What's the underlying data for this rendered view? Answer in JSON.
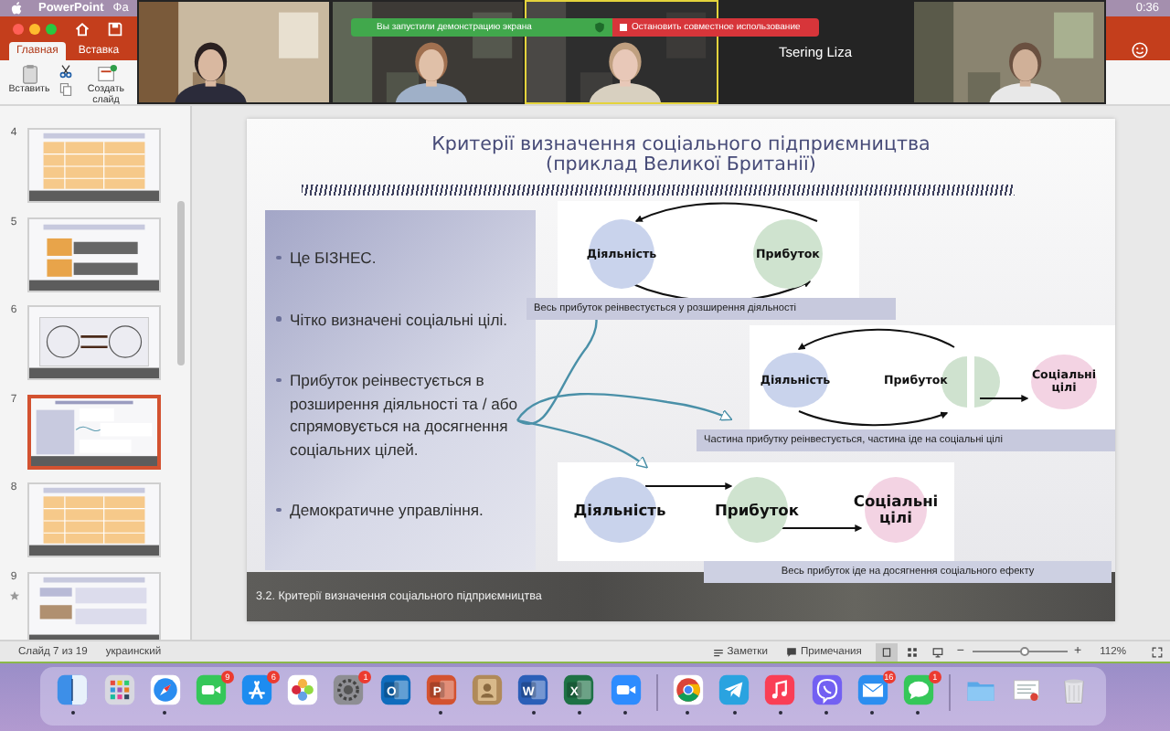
{
  "menu_bar": {
    "app": "PowerPoint",
    "menu_item": "Фа",
    "clock": "0:36"
  },
  "ribbon": {
    "tabs": [
      {
        "label": "Главная",
        "selected": true
      },
      {
        "label": "Вставка",
        "selected": false
      }
    ],
    "paste_label": "Вставить",
    "new_slide_label": "Создать слайд"
  },
  "meeting": {
    "share_notice": "Вы запустили демонстрацию экрана",
    "stop_share": "Остановить совместное использование",
    "participants": [
      {
        "kind": "picture",
        "active": false
      },
      {
        "kind": "picture",
        "active": false
      },
      {
        "kind": "picture",
        "active": true
      },
      {
        "kind": "name",
        "name": "Tsering Liza",
        "active": false
      },
      {
        "kind": "picture",
        "active": false
      }
    ]
  },
  "thumbnails": [
    {
      "number": "4",
      "kind": "table",
      "selected": false,
      "starred": false
    },
    {
      "number": "5",
      "kind": "boxes",
      "selected": false,
      "starred": false
    },
    {
      "number": "6",
      "kind": "cycle",
      "selected": false,
      "starred": false
    },
    {
      "number": "7",
      "kind": "criteria",
      "selected": true,
      "starred": false
    },
    {
      "number": "8",
      "kind": "table",
      "selected": false,
      "starred": false
    },
    {
      "number": "9",
      "kind": "mixed",
      "selected": false,
      "starred": true
    }
  ],
  "slide": {
    "title": [
      "Критерії визначення соціального підприємництва",
      "(приклад Великої Британії)"
    ],
    "bullets": [
      "Це БІЗНЕС.",
      "Чітко визначені соціальні цілі.",
      "Прибуток реінвестується в розширення діяльності та / або спрямовується на досягнення соціальних цілей.",
      "Демократичне управління."
    ],
    "diagrams": [
      {
        "kind": "cycle",
        "nodes": [
          "Діяльність",
          "Прибуток"
        ],
        "caption": "Весь прибуток реінвестується у розширення діяльності"
      },
      {
        "kind": "split",
        "nodes": [
          "Діяльність",
          "Прибуток",
          "Соціальні цілі"
        ],
        "caption": "Частина прибутку реінвестується, частина іде на соціальні цілі"
      },
      {
        "kind": "chain",
        "nodes": [
          "Діяльність",
          "Прибуток",
          "Соціальні цілі"
        ],
        "caption": "Весь прибуток іде на досягнення соціального ефекту"
      }
    ],
    "footer": "3.2. Критерії визначення соціального підприємництва"
  },
  "status_bar": {
    "slide_info": "Слайд 7 из 19",
    "language": "украинский",
    "notes": "Заметки",
    "comments": "Примечания",
    "views": [
      {
        "kind": "normal",
        "selected": true
      },
      {
        "kind": "sorter",
        "selected": false
      },
      {
        "kind": "reading",
        "selected": false
      }
    ],
    "zoom": {
      "minus": "−",
      "plus": "+",
      "level": 0.55,
      "value": "112%"
    }
  },
  "dock": {
    "groups": [
      [
        {
          "kind": "finder",
          "running": true
        },
        {
          "kind": "launchpad",
          "running": false
        },
        {
          "kind": "safari",
          "running": true
        },
        {
          "kind": "facetime",
          "badge": "9",
          "running": false
        },
        {
          "kind": "appstore",
          "badge": "6",
          "running": false
        },
        {
          "kind": "photos",
          "running": false
        },
        {
          "kind": "settings",
          "badge": "1",
          "running": false
        },
        {
          "kind": "outlook",
          "glyph": "O",
          "running": false
        },
        {
          "kind": "powerpoint",
          "glyph": "P",
          "running": true
        },
        {
          "kind": "contacts",
          "running": false
        },
        {
          "kind": "word",
          "glyph": "W",
          "running": true
        },
        {
          "kind": "excel",
          "glyph": "X",
          "running": true
        },
        {
          "kind": "zoom",
          "running": true
        }
      ],
      [
        {
          "kind": "chrome",
          "running": true
        },
        {
          "kind": "telegram",
          "running": true
        },
        {
          "kind": "music",
          "running": true
        },
        {
          "kind": "viber",
          "running": true
        },
        {
          "kind": "mail",
          "badge": "16",
          "running": true
        },
        {
          "kind": "messages",
          "badge": "1",
          "running": true
        }
      ],
      [
        {
          "kind": "folder",
          "running": false
        },
        {
          "kind": "downloads",
          "running": false
        },
        {
          "kind": "trash",
          "running": false
        }
      ]
    ]
  }
}
